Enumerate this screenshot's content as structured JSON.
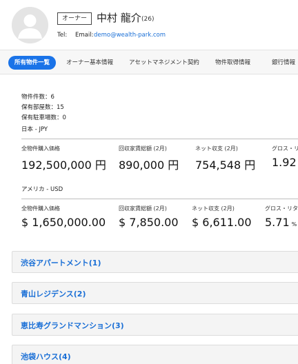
{
  "owner": {
    "role": "オーナー",
    "name": "中村 龍介",
    "age": "(26)",
    "tel_label": "Tel:",
    "email_label": "Email:",
    "email": "demo@wealth-park.com"
  },
  "tabs": [
    {
      "label": "所有物件一覧",
      "active": true
    },
    {
      "label": "オーナー基本情報",
      "active": false
    },
    {
      "label": "アセットマネジメント契約",
      "active": false
    },
    {
      "label": "物件取得情報",
      "active": false
    },
    {
      "label": "銀行情報",
      "active": false
    }
  ],
  "stats": {
    "property_count": "物件件数：6",
    "room_count": "保有部屋数：15",
    "parking_count": "保有駐車場数：0"
  },
  "japan": {
    "title": "日本 - JPY",
    "items": [
      {
        "label": "全物件購入価格",
        "value": "192,500,000 円",
        "unit": ""
      },
      {
        "label": "回収家賃総額 (2月)",
        "value": "890,000 円",
        "unit": ""
      },
      {
        "label": "ネット収支 (2月)",
        "value": "754,548 円",
        "unit": ""
      },
      {
        "label": "グロス・リ",
        "value": "1.92",
        "unit": ""
      }
    ]
  },
  "usa": {
    "title": "アメリカ - USD",
    "items": [
      {
        "label": "全物件購入価格",
        "value": "$ 1,650,000.00",
        "unit": ""
      },
      {
        "label": "回収家賃総額 (2月)",
        "value": "$ 7,850.00",
        "unit": ""
      },
      {
        "label": "ネット収支 (2月)",
        "value": "$ 6,611.00",
        "unit": ""
      },
      {
        "label": "グロス・リタ",
        "value": "5.71",
        "unit": "%"
      }
    ]
  },
  "properties": [
    {
      "label": "渋谷アパートメント(1)"
    },
    {
      "label": "青山レジデンス(2)"
    },
    {
      "label": "恵比寿グランドマンション(3)"
    },
    {
      "label": "池袋ハウス(4)"
    }
  ]
}
